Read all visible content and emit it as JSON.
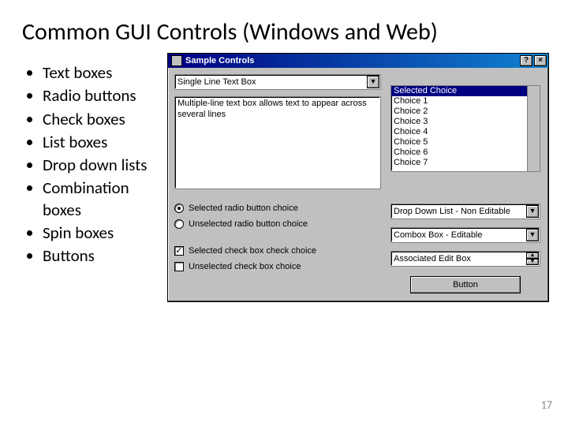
{
  "title": "Common GUI Controls (Windows and Web)",
  "bullets": [
    "Text boxes",
    "Radio buttons",
    "Check boxes",
    "List boxes",
    "Drop down lists",
    "Combination boxes",
    "Spin boxes",
    "Buttons"
  ],
  "win": {
    "title": "Sample Controls",
    "help_btn": "?",
    "close_btn": "×",
    "single_line": "Single Line Text Box",
    "multiline": "Multiple-line text box allows text to appear across several lines",
    "radio_selected": "Selected radio button choice",
    "radio_unselected": "Unselected radio button choice",
    "check_selected": "Selected check box check choice",
    "check_unselected": "Unselected check box choice",
    "check_mark": "✓",
    "list_items": [
      "Selected Choice",
      "Choice 1",
      "Choice 2",
      "Choice 3",
      "Choice 4",
      "Choice 5",
      "Choice 6",
      "Choice 7"
    ],
    "dropdown": "Drop Down List - Non Editable",
    "combo": "Combox Box - Editable",
    "spin": "Associated Edit Box",
    "button": "Button",
    "arrow_down": "▼",
    "arrow_up": "▲"
  },
  "page_number": "17"
}
